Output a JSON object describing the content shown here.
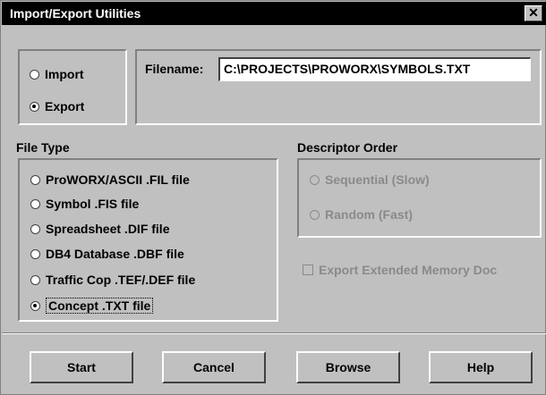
{
  "window": {
    "title": "Import/Export Utilities",
    "close_glyph": "✕"
  },
  "mode": {
    "import_label": "Import",
    "export_label": "Export",
    "selected": "Export"
  },
  "filename": {
    "label": "Filename:",
    "value": "C:\\PROJECTS\\PROWORX\\SYMBOLS.TXT"
  },
  "file_type": {
    "heading": "File Type",
    "options": [
      "ProWORX/ASCII .FIL file",
      "Symbol .FIS file",
      "Spreadsheet .DIF file",
      "DB4 Database .DBF file",
      "Traffic Cop .TEF/.DEF file",
      "Concept .TXT file"
    ],
    "selected": "Concept .TXT file"
  },
  "descriptor_order": {
    "heading": "Descriptor Order",
    "options": [
      "Sequential (Slow)",
      "Random (Fast)"
    ]
  },
  "export_extended": {
    "label": "Export Extended Memory Doc",
    "checked": false
  },
  "buttons": {
    "start": "Start",
    "cancel": "Cancel",
    "browse": "Browse",
    "help": "Help"
  }
}
